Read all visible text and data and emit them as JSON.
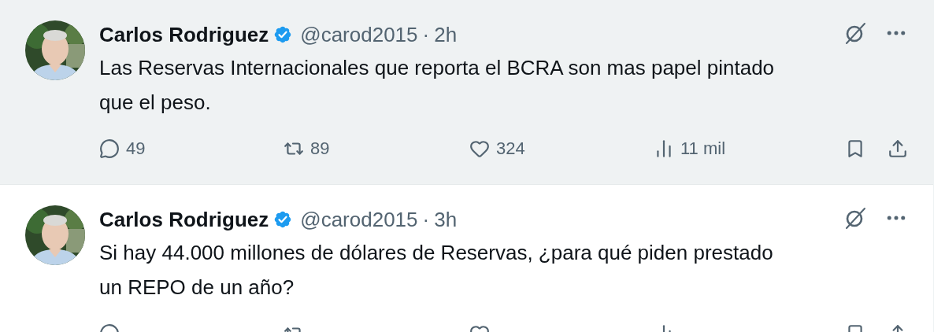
{
  "tweets": [
    {
      "name": "Carlos Rodriguez",
      "verified": true,
      "handle": "@carod2015",
      "separator": "·",
      "time": "2h",
      "highlighted": true,
      "text": "Las Reservas Internacionales que reporta el BCRA son mas papel pintado que el peso.",
      "stats": {
        "replies": "49",
        "reposts": "89",
        "likes": "324",
        "views": "11 mil"
      }
    },
    {
      "name": "Carlos Rodriguez",
      "verified": true,
      "handle": "@carod2015",
      "separator": "·",
      "time": "3h",
      "highlighted": false,
      "text": "Si hay 44.000 millones de dólares de Reservas, ¿para qué piden prestado un REPO de un año?"
    }
  ]
}
